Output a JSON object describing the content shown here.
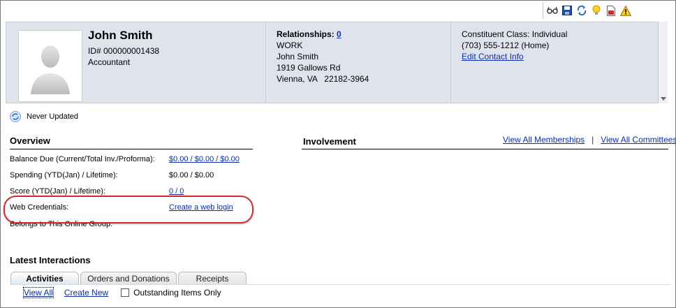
{
  "toolbar": {
    "icons": [
      "glasses-icon",
      "save-icon",
      "refresh-icon",
      "lightbulb-icon",
      "document-icon",
      "warning-icon"
    ]
  },
  "header": {
    "name": "John Smith",
    "id_line": "ID# 000000001438",
    "job_title": "Accountant",
    "relationships_label": "Relationships:",
    "relationships_count": "0",
    "address_type": "WORK",
    "address_name": "John Smith",
    "address_street": "1919 Gallows Rd",
    "address_city": "Vienna, VA   22182-3964",
    "constituent_class": "Constituent Class: Individual",
    "phone": "(703) 555-1212 (Home)",
    "edit_contact": "Edit Contact Info"
  },
  "status": {
    "updated": "Never Updated"
  },
  "overview": {
    "title": "Overview",
    "rows": [
      {
        "label": "Balance Due (Current/Total Inv./Proforma):",
        "value": "$0.00 / $0.00 / $0.00",
        "link": true
      },
      {
        "label": "Spending (YTD(Jan) / Lifetime):",
        "value": "$0.00 / $0.00",
        "link": false
      },
      {
        "label": "Score (YTD(Jan) / Lifetime):",
        "value": "0 / 0",
        "link": true
      },
      {
        "label": "Web Credentials:",
        "value": "Create a web login",
        "link": true
      },
      {
        "label": "Belongs to This Online Group:",
        "value": "",
        "link": false
      }
    ]
  },
  "involvement": {
    "title": "Involvement",
    "view_memberships": "View All Memberships",
    "separator": "|",
    "view_committees": "View All Committees"
  },
  "interactions": {
    "title": "Latest Interactions",
    "tabs": [
      "Activities",
      "Orders and Donations",
      "Receipts"
    ],
    "view_all": "View All",
    "create_new": "Create New",
    "outstanding_only": "Outstanding Items Only"
  },
  "colors": {
    "link": "#0a2ea8",
    "header_bg": "#dfe3ec",
    "highlight": "#d4282c"
  }
}
